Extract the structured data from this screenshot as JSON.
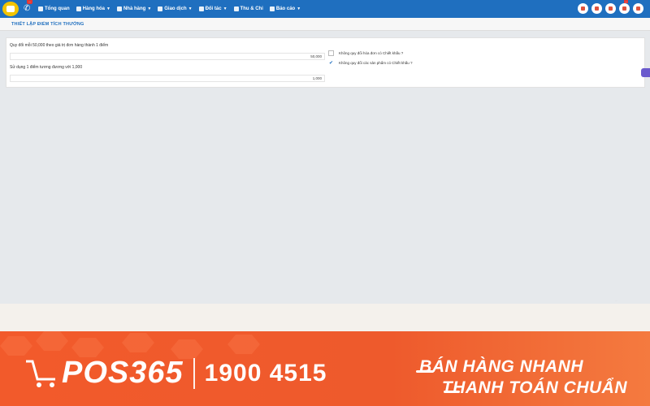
{
  "topbar": {
    "phone_badge": "...",
    "nav": [
      {
        "label": "Tổng quan",
        "caret": false
      },
      {
        "label": "Hàng hóa",
        "caret": true
      },
      {
        "label": "Nhà hàng",
        "caret": true
      },
      {
        "label": "Giao dịch",
        "caret": true
      },
      {
        "label": "Đối tác",
        "caret": true
      },
      {
        "label": "Thu & Chi",
        "caret": false
      },
      {
        "label": "Báo cáo",
        "caret": true
      }
    ],
    "notif_badge": "...",
    "user_tag": "..."
  },
  "page": {
    "title": "THIẾT LẬP ĐIỂM TÍCH THƯỞNG",
    "convert_label": "Quy đổi mỗi 50,000 theo giá trị đơn hàng thành 1 điểm",
    "convert_value": "50,000",
    "use_label": "Sử dụng 1 điểm tương đương với 1,000",
    "use_value": "1,000",
    "option1_label": "Không quy đổi hóa đơn có Chiết khấu ?",
    "option2_label": "Không quy đổi các sản phẩm có Chiết khấu ?",
    "option1_checked": false,
    "option2_checked": true,
    "footnote": "..."
  },
  "banner": {
    "brand": "POS365",
    "hotline": "1900 4515",
    "slogan_line1": "BÁN HÀNG NHANH",
    "slogan_line2": "THANH TOÁN CHUẨN"
  },
  "colors": {
    "nav_bg": "#1f6fbf",
    "accent": "#1f6fbf",
    "banner_orange": "#f25a2b"
  },
  "icons": {
    "logo": "pos365-logo",
    "phone": "phone-icon",
    "nav": [
      "dashboard-icon",
      "products-icon",
      "restaurant-icon",
      "transactions-icon",
      "partners-icon",
      "cashbook-icon",
      "reports-icon"
    ],
    "toolbar": [
      "cart-icon",
      "edit-icon",
      "location-icon",
      "gift-icon",
      "settings-icon"
    ]
  }
}
